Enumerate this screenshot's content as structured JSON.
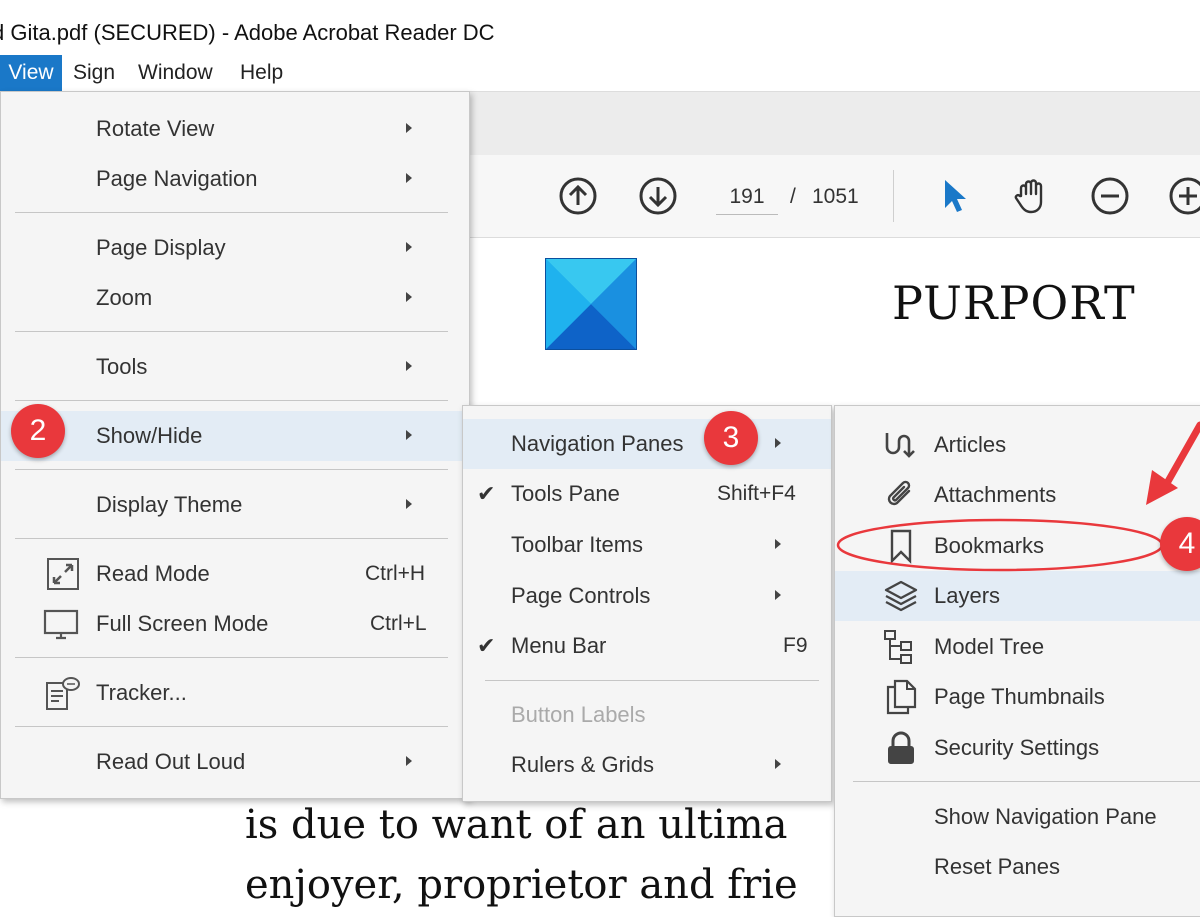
{
  "window": {
    "title": "d Gita.pdf (SECURED) - Adobe Acrobat Reader DC"
  },
  "menubar": {
    "items": [
      "View",
      "Sign",
      "Window",
      "Help"
    ]
  },
  "toolbar": {
    "page_current": "191",
    "page_separator": "/",
    "page_total": "1051"
  },
  "document": {
    "heading": "PURPORT",
    "lines": [
      "is due to want of an ultima",
      "enjoyer, proprietor and frie"
    ]
  },
  "view_menu": {
    "items": [
      {
        "label": "Rotate View"
      },
      {
        "label": "Page Navigation"
      },
      {
        "label": "Page Display"
      },
      {
        "label": "Zoom"
      },
      {
        "label": "Tools"
      },
      {
        "label": "Show/Hide"
      },
      {
        "label": "Display Theme"
      },
      {
        "label": "Read Mode",
        "shortcut": "Ctrl+H"
      },
      {
        "label": "Full Screen Mode",
        "shortcut": "Ctrl+L"
      },
      {
        "label": "Tracker..."
      },
      {
        "label": "Read Out Loud"
      }
    ]
  },
  "showhide_menu": {
    "items": [
      {
        "label": "Navigation Panes"
      },
      {
        "label": "Tools Pane",
        "shortcut": "Shift+F4"
      },
      {
        "label": "Toolbar Items"
      },
      {
        "label": "Page Controls"
      },
      {
        "label": "Menu Bar",
        "shortcut": "F9"
      },
      {
        "label": "Button Labels"
      },
      {
        "label": "Rulers & Grids"
      }
    ]
  },
  "navpanes_menu": {
    "items": [
      {
        "label": "Articles"
      },
      {
        "label": "Attachments"
      },
      {
        "label": "Bookmarks"
      },
      {
        "label": "Layers"
      },
      {
        "label": "Model Tree"
      },
      {
        "label": "Page Thumbnails"
      },
      {
        "label": "Security Settings"
      },
      {
        "label": "Show Navigation Pane"
      },
      {
        "label": "Reset Panes"
      }
    ]
  },
  "callouts": [
    "2",
    "3",
    "4"
  ],
  "colors": {
    "accent": "#1a78c8",
    "callout": "#e9383c",
    "highlight": "#e3ecf5"
  }
}
